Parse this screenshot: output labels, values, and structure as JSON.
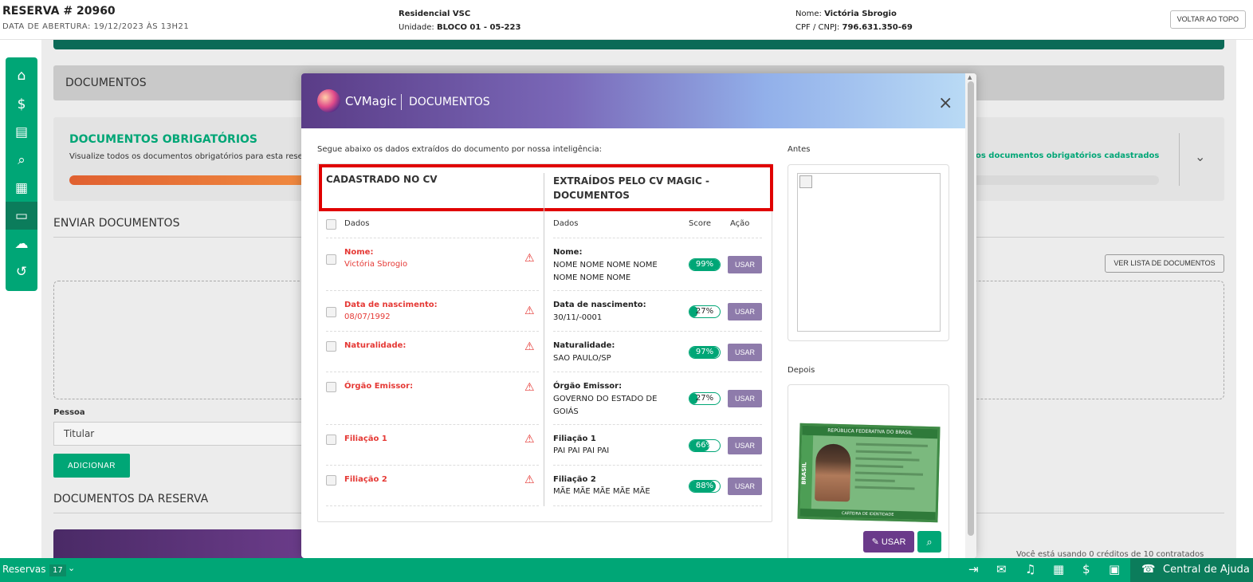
{
  "header": {
    "title": "RESERVA # 20960",
    "opening_date": "DATA DE ABERTURA: 19/12/2023 ÀS 13H21",
    "enterprise": "Residencial VSC",
    "unit_label": "Unidade:",
    "unit_value": "BLOCO 01 - 05-223",
    "name_label": "Nome:",
    "name_value": "Victória Sbrogio",
    "cpf_label": "CPF / CNPJ:",
    "cpf_value": "796.631.350-69",
    "back_to_top": "VOLTAR AO TOPO"
  },
  "sidebar": {
    "items": [
      {
        "icon": "home-icon",
        "glyph": "⌂"
      },
      {
        "icon": "dollar-icon",
        "glyph": "$"
      },
      {
        "icon": "invoice-icon",
        "glyph": "▤"
      },
      {
        "icon": "search-money-icon",
        "glyph": "⌕"
      },
      {
        "icon": "document-icon",
        "glyph": "▦"
      },
      {
        "icon": "folder-icon",
        "glyph": "▭"
      },
      {
        "icon": "chat-icon",
        "glyph": "☁"
      },
      {
        "icon": "history-icon",
        "glyph": "↺"
      }
    ]
  },
  "page": {
    "documents_bar": "DOCUMENTOS",
    "required_title": "DOCUMENTOS OBRIGATÓRIOS",
    "required_desc": "Visualize todos os documentos obrigatórios para esta rese",
    "required_link": "os documentos obrigatórios cadastrados",
    "send_title": "ENVIAR DOCUMENTOS",
    "list_button": "VER LISTA DE DOCUMENTOS",
    "person_label": "Pessoa",
    "person_value": "Titular",
    "add_button": "ADICIONAR",
    "reservation_docs_title": "DOCUMENTOS DA RESERVA",
    "credits_text": "Você está usando 0 créditos de 10 contratados"
  },
  "bottom_bar": {
    "reservations_label": "Reservas",
    "reservations_count": "17",
    "help_label": "Central de Ajuda"
  },
  "modal": {
    "brand": "CVMagic",
    "title": "DOCUMENTOS",
    "close": "×",
    "intro": "Segue abaixo os dados extraídos do documento por nossa inteligência:",
    "col_left_title": "CADASTRADO NO CV",
    "col_right_title": "EXTRAÍDOS PELO CV MAGIC - DOCUMENTOS",
    "th_data_left": "Dados",
    "th_data_right": "Dados",
    "th_score": "Score",
    "th_action": "Ação",
    "rows": [
      {
        "label": "Nome:",
        "cv_value": "Victória Sbrogio",
        "ext_label": "Nome:",
        "ext_value": "NOME NOME NOME NOME NOME NOME NOME",
        "score_text": "99%",
        "score": 99,
        "action": "USAR"
      },
      {
        "label": "Data de nascimento:",
        "cv_value": "08/07/1992",
        "ext_label": "Data de nascimento:",
        "ext_value": "30/11/-0001",
        "score_text": "27%",
        "score": 27,
        "action": "USAR"
      },
      {
        "label": "Naturalidade:",
        "cv_value": "",
        "ext_label": "Naturalidade:",
        "ext_value": "SAO PAULO/SP",
        "score_text": "97%",
        "score": 97,
        "action": "USAR"
      },
      {
        "label": "Órgão Emissor:",
        "cv_value": "",
        "ext_label": "Órgão Emissor:",
        "ext_value": "GOVERNO DO ESTADO DE GOIÁS",
        "score_text": "27%",
        "score": 27,
        "action": "USAR"
      },
      {
        "label": "Filiação 1",
        "cv_value": "",
        "ext_label": "Filiação 1",
        "ext_value": "PAI PAI PAI PAI",
        "score_text": "66%",
        "score": 66,
        "action": "USAR"
      },
      {
        "label": "Filiação 2",
        "cv_value": "",
        "ext_label": "Filiação 2",
        "ext_value": "MÃE MÃE MÃE MÃE MÃE",
        "score_text": "88%",
        "score": 88,
        "action": "USAR"
      }
    ],
    "before_label": "Antes",
    "after_label": "Depois",
    "id_card": {
      "header": "REPÚBLICA FEDERATIVA DO BRASIL",
      "side": "BRASIL",
      "footer": "CARTEIRA DE IDENTIDADE"
    },
    "use_button": "USAR",
    "search_icon": "search-icon"
  },
  "colors": {
    "accent": "#00a676",
    "dark_green": "#0b6a57",
    "alert_red": "#e53935",
    "action_purple": "#8e7bab",
    "brand_purple": "#6a3a8a"
  }
}
